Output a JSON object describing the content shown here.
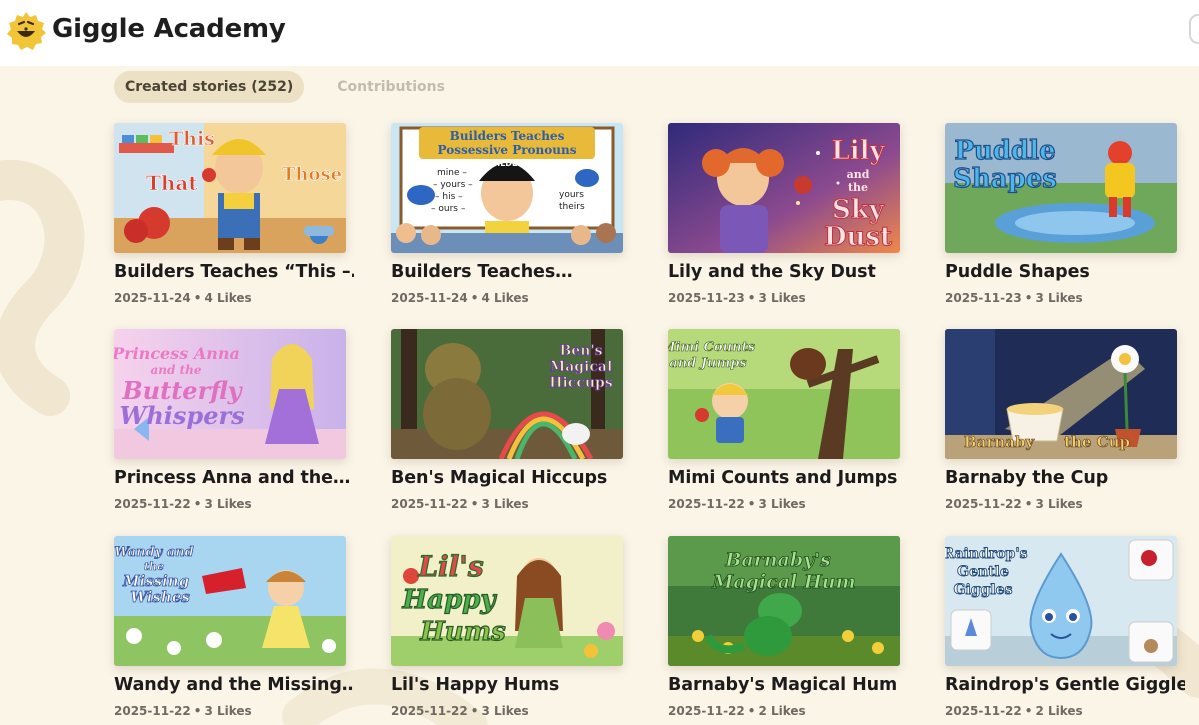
{
  "header": {
    "brand": "Giggle Academy"
  },
  "tabs": [
    {
      "label": "Created stories (252)",
      "active": true
    },
    {
      "label": "Contributions",
      "active": false
    }
  ],
  "stories": [
    {
      "title": "Builders Teaches “This –…",
      "date": "2025-11-24",
      "likes": "4 Likes",
      "thumb": {
        "lines": [
          "This",
          "That",
          "Those"
        ],
        "colors": [
          "#f2b25c",
          "#6fb3e6"
        ]
      }
    },
    {
      "title": "Builders Teaches…",
      "date": "2025-11-24",
      "likes": "4 Likes",
      "thumb": {
        "lines": [
          "Builders Teaches",
          "Possessive Pronouns",
          "mine",
          "yours",
          "his",
          "ours",
          "yours",
          "theirs",
          "BUILDERS"
        ],
        "colors": [
          "#c9e6f5",
          "#f3d35a"
        ]
      }
    },
    {
      "title": "Lily and the Sky Dust",
      "date": "2025-11-23",
      "likes": "3 Likes",
      "thumb": {
        "lines": [
          "Lily",
          "and",
          "the",
          "Sky",
          "Dust"
        ],
        "colors": [
          "#3b2d7a",
          "#e97a3d"
        ]
      }
    },
    {
      "title": "Puddle Shapes",
      "date": "2025-11-23",
      "likes": "3 Likes",
      "thumb": {
        "lines": [
          "Puddle",
          "Shapes"
        ],
        "colors": [
          "#9ac4e0",
          "#6fa85a"
        ]
      }
    },
    {
      "title": "Princess Anna and the…",
      "date": "2025-11-22",
      "likes": "3 Likes",
      "thumb": {
        "lines": [
          "Princess Anna",
          "and the",
          "Butterfly",
          "Whispers"
        ],
        "colors": [
          "#f4d6ee",
          "#c7a7e6"
        ]
      }
    },
    {
      "title": "Ben's Magical Hiccups",
      "date": "2025-11-22",
      "likes": "3 Likes",
      "thumb": {
        "lines": [
          "Ben's",
          "Magical",
          "Hiccups"
        ],
        "colors": [
          "#3d5a34",
          "#b6a06a"
        ]
      }
    },
    {
      "title": "Mimi Counts and Jumps",
      "date": "2025-11-22",
      "likes": "3 Likes",
      "thumb": {
        "lines": [
          "Mimi Counts",
          "and Jumps"
        ],
        "colors": [
          "#7fb84c",
          "#4b7c34"
        ]
      }
    },
    {
      "title": "Barnaby the Cup",
      "date": "2025-11-22",
      "likes": "3 Likes",
      "thumb": {
        "lines": [
          "Barnaby",
          "the Cup"
        ],
        "colors": [
          "#1f2d56",
          "#f1d68a"
        ]
      }
    },
    {
      "title": "Wandy and the Missing…",
      "date": "2025-11-22",
      "likes": "3 Likes",
      "thumb": {
        "lines": [
          "Wandy and",
          "the",
          "Missing",
          "Wishes"
        ],
        "colors": [
          "#a8d6f0",
          "#8fc463"
        ]
      }
    },
    {
      "title": "Lil's Happy Hums",
      "date": "2025-11-22",
      "likes": "3 Likes",
      "thumb": {
        "lines": [
          "Lil's",
          "Happy",
          "Hums"
        ],
        "colors": [
          "#f2f0c8",
          "#9fcf6a"
        ]
      }
    },
    {
      "title": "Barnaby's Magical Hum",
      "date": "2025-11-22",
      "likes": "2 Likes",
      "thumb": {
        "lines": [
          "Barnaby's",
          "Magical Hum"
        ],
        "colors": [
          "#3f7a3a",
          "#f2cf3a"
        ]
      }
    },
    {
      "title": "Raindrop's Gentle Giggles",
      "date": "2025-11-22",
      "likes": "2 Likes",
      "thumb": {
        "lines": [
          "Raindrop's",
          "Gentle",
          "Giggles"
        ],
        "colors": [
          "#d8e8f0",
          "#9fc7e3"
        ]
      }
    }
  ]
}
